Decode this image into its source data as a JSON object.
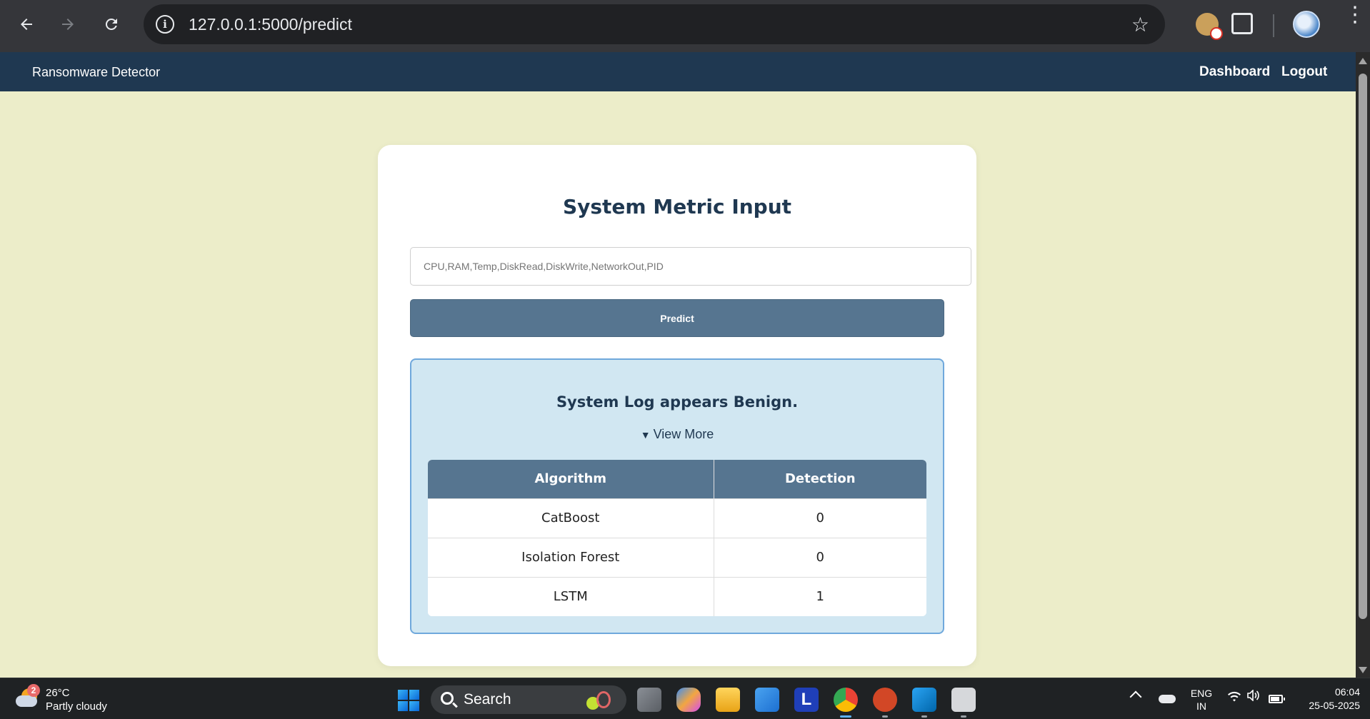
{
  "browser": {
    "url": "127.0.0.1:5000/predict"
  },
  "app_nav": {
    "brand": "Ransomware Detector",
    "links": [
      "Dashboard",
      "Logout"
    ]
  },
  "form": {
    "title": "System Metric Input",
    "input_placeholder": "CPU,RAM,Temp,DiskRead,DiskWrite,NetworkOut,PID",
    "input_value": "",
    "submit_label": "Predict"
  },
  "result": {
    "message": "System Log appears Benign.",
    "toggle_label": "View More",
    "toggle_icon": "triangle-down",
    "columns": [
      "Algorithm",
      "Detection"
    ],
    "rows": [
      {
        "algorithm": "CatBoost",
        "detection": "0"
      },
      {
        "algorithm": "Isolation Forest",
        "detection": "0"
      },
      {
        "algorithm": "LSTM",
        "detection": "1"
      }
    ]
  },
  "colors": {
    "page_bg": "#ecedc9",
    "navbar_bg": "#1f3851",
    "accent": "#567590",
    "result_bg": "#d1e7f2",
    "result_border": "#6fa8dc"
  },
  "taskbar": {
    "weather": {
      "badge": "2",
      "temp": "26°C",
      "condition": "Partly cloudy"
    },
    "search_label": "Search",
    "lang": [
      "ENG",
      "IN"
    ],
    "time": "06:04",
    "date": "25-05-2025"
  }
}
